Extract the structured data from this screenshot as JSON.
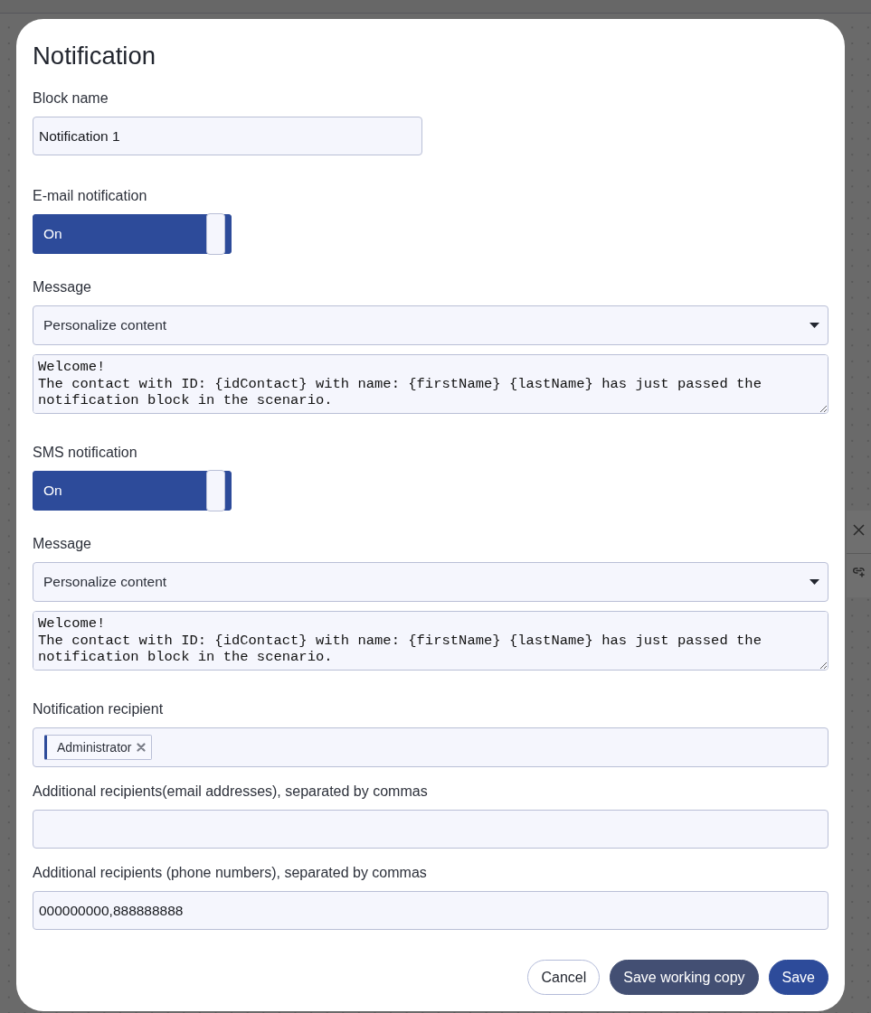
{
  "dialog": {
    "title": "Notification"
  },
  "block_name": {
    "label": "Block name",
    "value": "Notification 1"
  },
  "channels": [
    {
      "label": "E-mail notification",
      "toggle": {
        "on": true,
        "text": "On"
      },
      "message_label": "Message",
      "personalize": {
        "text": "Personalize content"
      },
      "message": "Welcome!\nThe contact with ID: {idContact} with name: {firstName} {lastName} has just passed the notification block in the scenario."
    },
    {
      "label": "SMS notification",
      "toggle": {
        "on": true,
        "text": "On"
      },
      "message_label": "Message",
      "personalize": {
        "text": "Personalize content"
      },
      "message": "Welcome!\nThe contact with ID: {idContact} with name: {firstName} {lastName} has just passed the notification block in the scenario."
    }
  ],
  "recipient": {
    "label": "Notification recipient",
    "tags": [
      {
        "text": "Administrator"
      }
    ]
  },
  "email_recipients": {
    "label": "Additional recipients(email addresses), separated by commas"
  },
  "phone_recipients": {
    "label": "Additional recipients (phone numbers), separated by commas",
    "value": "000000000,888888888"
  },
  "buttons": [
    {
      "label": "Cancel",
      "kind": "secondary"
    },
    {
      "label": "Save working copy",
      "kind": "dark"
    },
    {
      "label": "Save",
      "kind": "primary"
    }
  ]
}
